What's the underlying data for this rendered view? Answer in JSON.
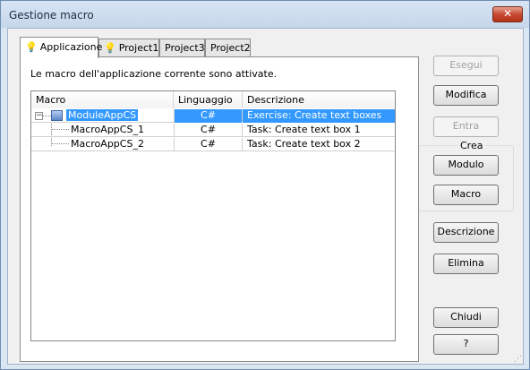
{
  "window": {
    "title": "Gestione macro",
    "close_label": "✕"
  },
  "tabs": [
    {
      "label": "Applicazione",
      "icon": "lightbulb-icon",
      "active": true
    },
    {
      "label": "Project1",
      "icon": "lightbulb-icon",
      "active": false
    },
    {
      "label": "Project3",
      "active": false
    },
    {
      "label": "Project2",
      "active": false
    }
  ],
  "panel": {
    "status_message": "Le macro dell'applicazione corrente sono attivate."
  },
  "table": {
    "columns": [
      "Macro",
      "Linguaggio",
      "Descrizione"
    ],
    "rows": [
      {
        "name": "ModuleAppCS",
        "language": "C#",
        "description": "Exercise: Create text boxes",
        "selected": true,
        "expander": "−"
      },
      {
        "name": "MacroAppCS_1",
        "language": "C#",
        "description": "Task: Create text box 1"
      },
      {
        "name": "MacroAppCS_2",
        "language": "C#",
        "description": "Task: Create text box 2"
      }
    ]
  },
  "buttons": {
    "esegui": "Esegui",
    "modifica": "Modifica",
    "entra": "Entra",
    "crea_group": "Crea",
    "modulo": "Modulo",
    "macro": "Macro",
    "descrizione": "Descrizione",
    "elimina": "Elimina",
    "chiudi": "Chiudi",
    "help": "?"
  }
}
